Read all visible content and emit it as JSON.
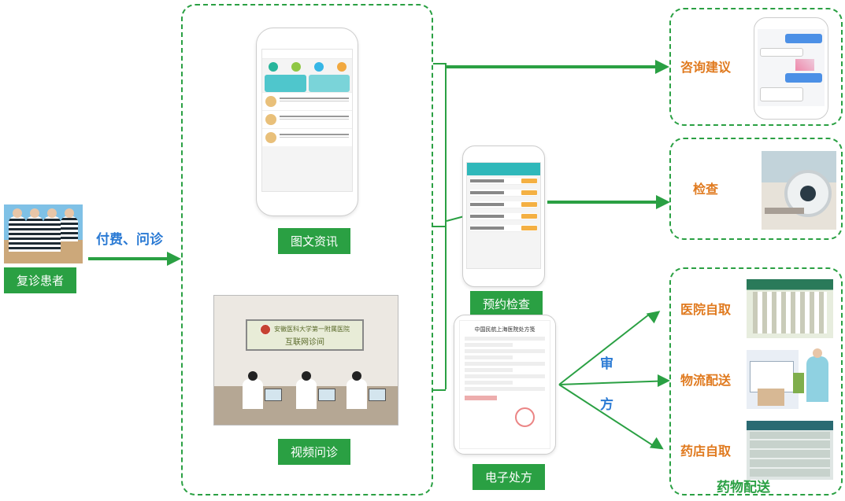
{
  "patient_label": "复诊患者",
  "arrow_pay_consult": "付费、问诊",
  "text_info_label": "图文资讯",
  "video_label": "视频问诊",
  "video_banner_top": "安徽医科大学第一附属医院",
  "video_banner_bottom": "互联网诊间",
  "appointment_label": "预约检查",
  "erx_label": "电子处方",
  "erx_title": "中国民航上海医院处方笺",
  "advice_label": "咨询建议",
  "exam_label": "检查",
  "drug_hospital": "医院自取",
  "drug_logistics": "物流配送",
  "drug_pharmacy": "药店自取",
  "drug_dist_label": "药物配送",
  "review_label_1": "审",
  "review_label_2": "方"
}
